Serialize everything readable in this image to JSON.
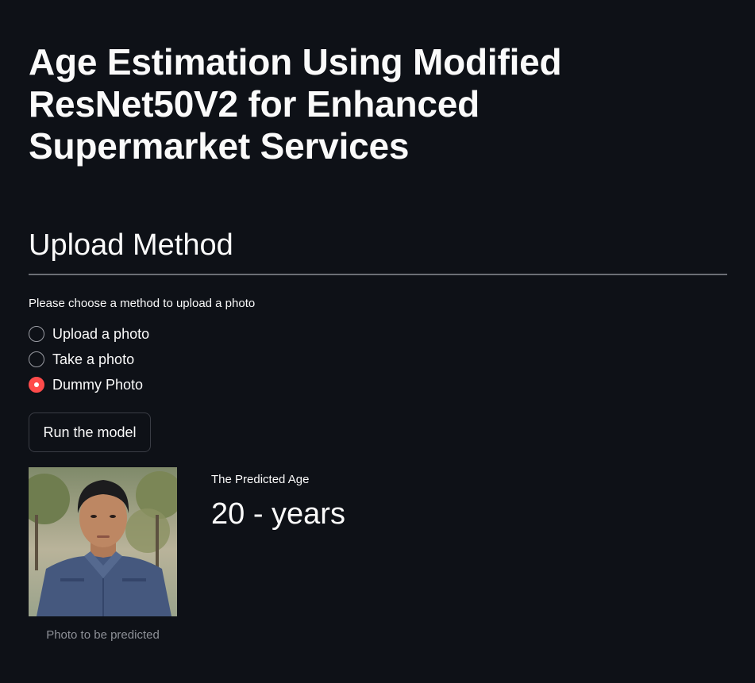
{
  "header": {
    "title": "Age Estimation Using Modified ResNet50V2 for Enhanced Supermarket Services"
  },
  "upload_section": {
    "heading": "Upload Method",
    "radio_label": "Please choose a method to upload a photo",
    "options": [
      {
        "label": "Upload a photo",
        "selected": false
      },
      {
        "label": "Take a photo",
        "selected": false
      },
      {
        "label": "Dummy Photo",
        "selected": true
      }
    ]
  },
  "actions": {
    "run_label": "Run the model"
  },
  "result": {
    "photo_caption": "Photo to be predicted",
    "metric_label": "The Predicted Age",
    "metric_value": "20 - years"
  },
  "colors": {
    "background": "#0e1117",
    "accent": "#ff4b4b",
    "text": "#fafafa",
    "muted": "#8d9097"
  }
}
